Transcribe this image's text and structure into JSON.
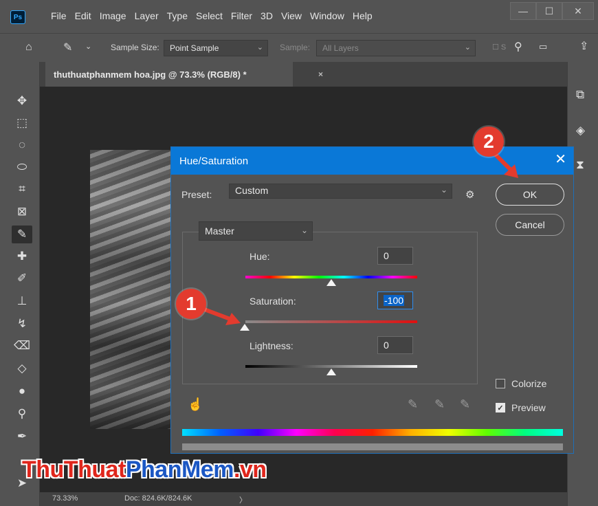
{
  "app": {
    "logo": "Ps",
    "menus": [
      "File",
      "Edit",
      "Image",
      "Layer",
      "Type",
      "Select",
      "Filter",
      "3D",
      "View",
      "Window",
      "Help"
    ]
  },
  "window_controls": {
    "minimize": "—",
    "maximize": "☐",
    "close": "✕"
  },
  "options_bar": {
    "sample_size_label": "Sample Size:",
    "sample_size_value": "Point Sample",
    "sample_label": "Sample:",
    "sample_value": "All Layers"
  },
  "document": {
    "tab_title": "thuthuatphanmem hoa.jpg @ 73.3% (RGB/8) *",
    "tab_close": "×"
  },
  "status": {
    "zoom": "73.33%",
    "doc": "Doc: 824.6K/824.6K",
    "arrow": "〉"
  },
  "dialog": {
    "title": "Hue/Saturation",
    "preset_label": "Preset:",
    "preset_value": "Custom",
    "ok_label": "OK",
    "cancel_label": "Cancel",
    "channel": "Master",
    "hue_label": "Hue:",
    "hue_value": "0",
    "saturation_label": "Saturation:",
    "saturation_value": "-100",
    "lightness_label": "Lightness:",
    "lightness_value": "0",
    "colorize_label": "Colorize",
    "colorize_checked": false,
    "preview_label": "Preview",
    "preview_checked": true,
    "slider_positions": {
      "hue": 0.5,
      "saturation": 0.0,
      "lightness": 0.5
    }
  },
  "annotations": {
    "step1": "1",
    "step2": "2",
    "accent": "#e33b2e"
  },
  "watermark": {
    "part1": "ThuThuat",
    "part2": "PhanMem",
    "part3": ".vn"
  },
  "colors": {
    "dialog_title_bar": "#0a78d7",
    "ui_background": "#535353",
    "canvas": "#282828"
  }
}
